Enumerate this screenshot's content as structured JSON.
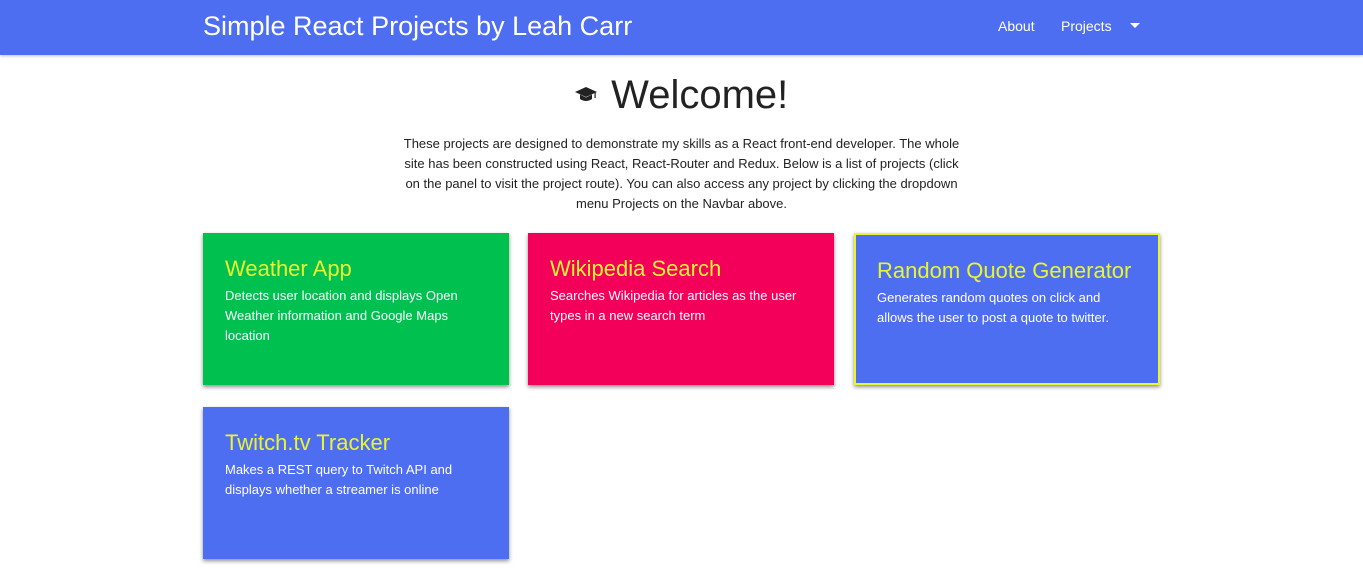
{
  "navbar": {
    "brand": "Simple React Projects by Leah Carr",
    "links": {
      "about": "About",
      "projects": "Projects"
    },
    "background_color": "#4e6ef2"
  },
  "main": {
    "icon": "graduation-cap-icon",
    "title": "Welcome!",
    "intro": "These projects are designed to demonstrate my skills as a React front-end developer. The whole site has been constructed using React, React-Router and Redux. Below is a list of projects (click on the panel to visit the project route). You can also access any project by clicking the dropdown menu Projects on the Navbar above."
  },
  "colors": {
    "title_accent": "#e9f52e",
    "green": "#00c04f",
    "pink": "#f2005a",
    "blue": "#4e6ef2"
  },
  "projects": [
    {
      "title": "Weather App",
      "description": "Detects user location and displays Open Weather information and Google Maps location",
      "color": "#00c04f"
    },
    {
      "title": "Wikipedia Search",
      "description": "Searches Wikipedia for articles as the user types in a new search term",
      "color": "#f2005a"
    },
    {
      "title": "Random Quote Generator",
      "description": "Generates random quotes on click and allows the user to post a quote to twitter.",
      "color": "#4e6ef2"
    },
    {
      "title": "Twitch.tv Tracker",
      "description": "Makes a REST query to Twitch API and displays whether a streamer is online",
      "color": "#4e6ef2"
    }
  ]
}
